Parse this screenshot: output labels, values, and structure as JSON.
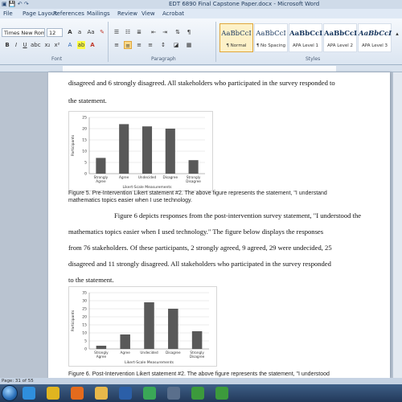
{
  "window": {
    "title": "EDT 6890 Final Capstone Paper.docx  -  Microsoft Word",
    "qat_icons": [
      "word-icon",
      "save-icon",
      "undo-icon",
      "redo-icon"
    ]
  },
  "tabs": [
    "File",
    "Page Layout",
    "References",
    "Mailings",
    "Review",
    "View",
    "Acrobat"
  ],
  "ribbon": {
    "font_name": "Times New Roman",
    "font_size": "12",
    "groups": [
      "Font",
      "Paragraph",
      "Styles"
    ],
    "styles": [
      {
        "sample": "AaBbCcI",
        "name": "¶ Normal"
      },
      {
        "sample": "AaBbCcI",
        "name": "¶ No Spacing"
      },
      {
        "sample": "AaBbCcI",
        "name": "APA Level 1"
      },
      {
        "sample": "AaBbCcI",
        "name": "APA Level 2"
      },
      {
        "sample": "AaBbCcI",
        "name": "APA Level 3"
      }
    ],
    "accent_selected": "#e0a63a"
  },
  "document": {
    "lines_top": [
      "disagreed and 6 strongly disagreed. All stakeholders who participated in the survey responded to",
      "the statement."
    ],
    "caption1": [
      "Figure 5. Pre-Intervention Likert statement #2. The above figure represents the statement, \"I understand",
      "mathematics topics easier when I use technology."
    ],
    "lines_middle": [
      "Figure 6 depicts responses from the post-intervention survey statement, \"I understood the",
      "mathematics topics easier when I used technology.\" The figure below displays the responses",
      "from 76 stakeholders. Of these participants, 2 strongly agreed, 9 agreed, 29 were undecided, 25",
      "disagreed and 11 strongly disagreed. All stakeholders who participated in the survey responded",
      "to the statement."
    ],
    "caption2": "Figure 6. Post-Intervention Likert statement #2. The above figure represents the statement, \"I understood"
  },
  "chart_data": [
    {
      "type": "bar",
      "categories": [
        "Strongly Agree",
        "Agree",
        "Undecided",
        "Disagree",
        "Strongly Disagree"
      ],
      "values": [
        7,
        22,
        21,
        20,
        6
      ],
      "xlabel": "Likert-Scale Measurements",
      "ylabel": "Participants",
      "ylim": [
        0,
        25
      ],
      "yticks": [
        0,
        5,
        10,
        15,
        20,
        25
      ],
      "bar_color": "#595959"
    },
    {
      "type": "bar",
      "categories": [
        "Strongly Agree",
        "Agree",
        "Undecided",
        "Disagree",
        "Strongly Disagree"
      ],
      "values": [
        2,
        9,
        29,
        25,
        11
      ],
      "xlabel": "Likert-Scale Measurements",
      "ylabel": "Participants",
      "ylim": [
        0,
        35
      ],
      "yticks": [
        0,
        5,
        10,
        15,
        20,
        25,
        30,
        35
      ],
      "bar_color": "#595959"
    }
  ],
  "statusbar": {
    "text": "Page: 31 of 55"
  },
  "taskbar": {
    "icons": [
      {
        "name": "ie-icon",
        "color": "#2f8fdd"
      },
      {
        "name": "chrome-icon",
        "color": "#e0b520"
      },
      {
        "name": "firefox-icon",
        "color": "#e46b1d"
      },
      {
        "name": "folder-icon",
        "color": "#e8b84a"
      },
      {
        "name": "word-taskbar-icon",
        "color": "#2b5fa8"
      },
      {
        "name": "chrome-taskbar-icon",
        "color": "#3aa757"
      },
      {
        "name": "media-icon",
        "color": "#5a6f8c"
      },
      {
        "name": "camtasia-icon",
        "color": "#3c9a3c"
      },
      {
        "name": "camtasia-recorder-icon",
        "color": "#3c9a3c"
      }
    ]
  }
}
